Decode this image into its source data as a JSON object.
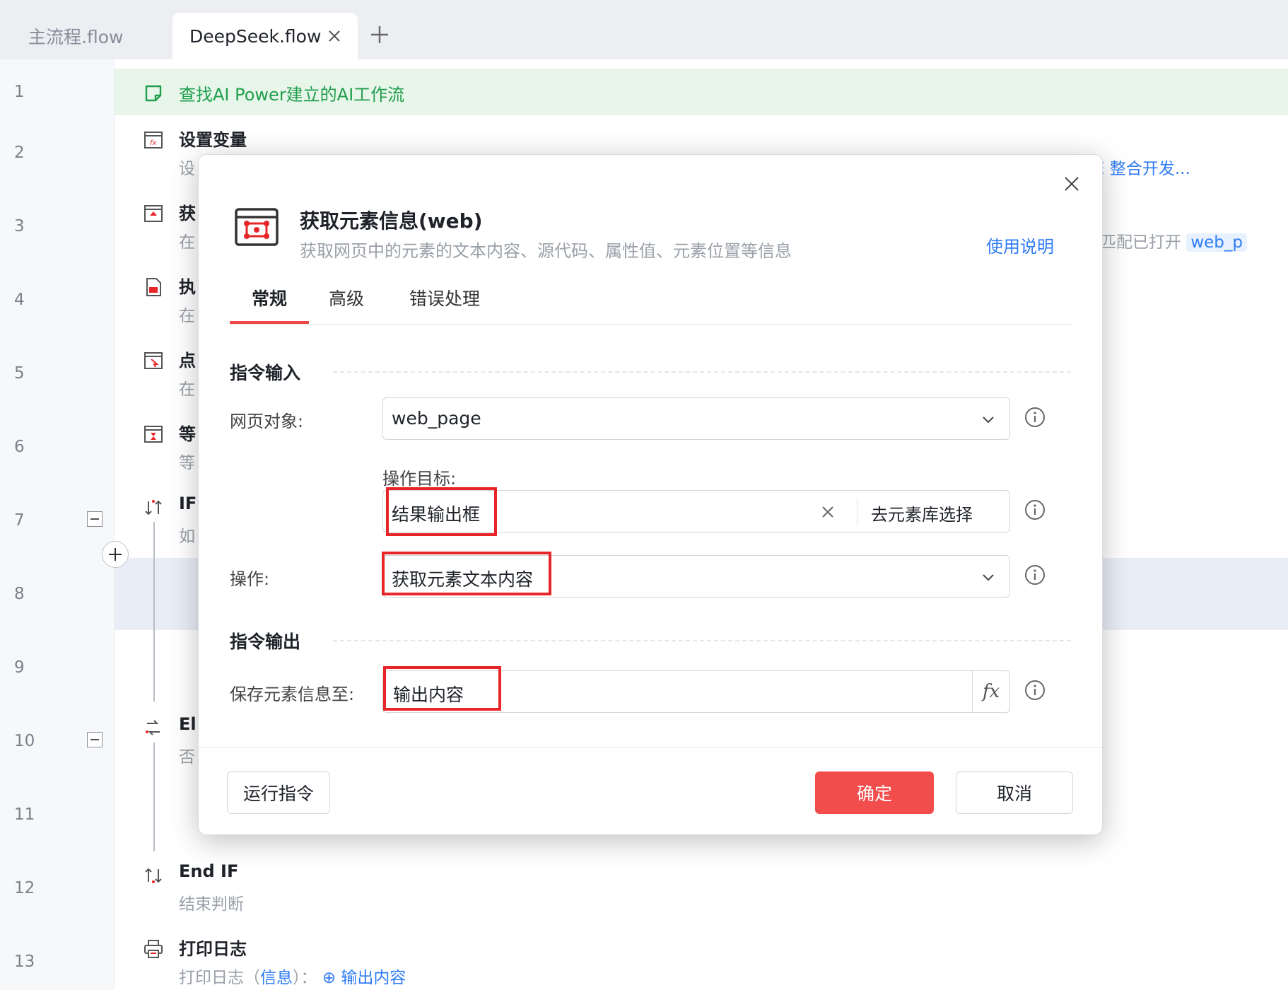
{
  "tabs": {
    "inactive_label": "主流程.flow",
    "active_label": "DeepSeek.flow"
  },
  "line_numbers": [
    "1",
    "2",
    "3",
    "4",
    "5",
    "6",
    "7",
    "8",
    "9",
    "10",
    "11",
    "12",
    "13"
  ],
  "flow": {
    "comment": "查找AI Power建立的AI工作流",
    "set_var": {
      "title": "设置变量",
      "desc": "设"
    },
    "row3": {
      "title": "获",
      "desc": "在"
    },
    "row4": {
      "title": "执",
      "desc": "在"
    },
    "row5": {
      "title": "点",
      "desc": "在"
    },
    "row6": {
      "title": "等",
      "desc": "等"
    },
    "if": {
      "title": "IF",
      "desc": "如"
    },
    "else": {
      "title": "El",
      "desc": "否"
    },
    "endif": {
      "title": "End IF",
      "desc": "结束判断"
    },
    "print": {
      "title": "打印日志",
      "desc_prefix": "打印日志（",
      "desc_level": "信息",
      "desc_mid": "）：",
      "desc_var": "输出内容"
    },
    "bg_row2_right": "E 整合开发...",
    "bg_row3_right_text": "匹配已打开",
    "bg_row3_right_var": "web_p"
  },
  "modal": {
    "title": "获取元素信息(web)",
    "subtitle": "获取网页中的元素的文本内容、源代码、属性值、元素位置等信息",
    "help_link": "使用说明",
    "tabs": [
      "常规",
      "高级",
      "错误处理"
    ],
    "section_input": "指令输入",
    "section_output": "指令输出",
    "web_object_label": "网页对象:",
    "web_object_value": "web_page",
    "target_label": "操作目标:",
    "target_value": "结果输出框",
    "target_pick_button": "去元素库选择",
    "operation_label": "操作:",
    "operation_value": "获取元素文本内容",
    "save_label": "保存元素信息至:",
    "save_value": "输出内容",
    "fx_label": "fx",
    "run_button": "运行指令",
    "ok_button": "确定",
    "cancel_button": "取消"
  },
  "colors": {
    "accent_red": "#f24c4c",
    "link_blue": "#2f7cf5",
    "comment_green": "#1e9e4c",
    "highlight_red_box": "#e8262a"
  }
}
